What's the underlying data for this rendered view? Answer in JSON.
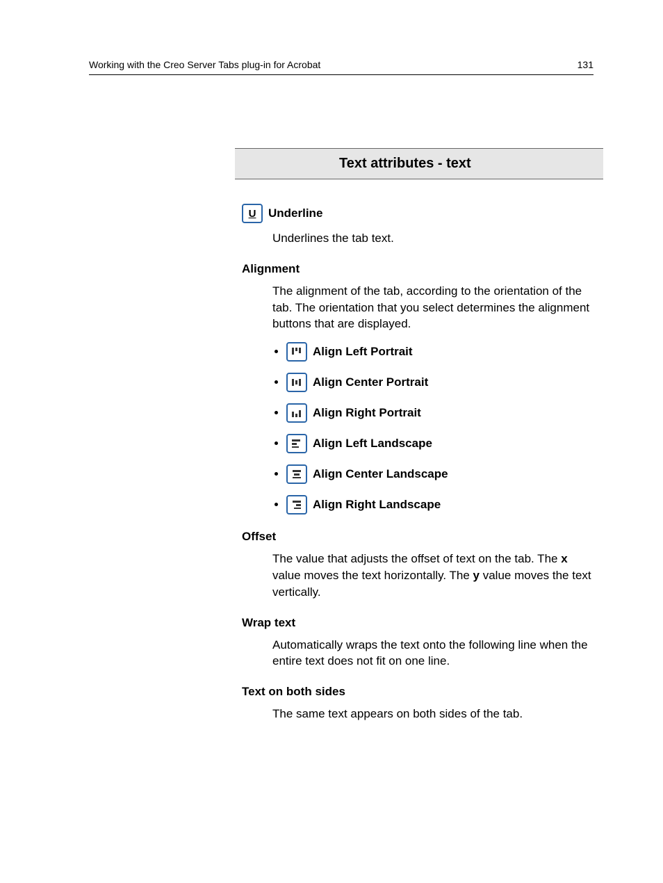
{
  "header": {
    "title": "Working with the Creo Server Tabs plug-in for Acrobat",
    "page": "131"
  },
  "section_title": "Text attributes - text",
  "underline": {
    "label": "Underline",
    "body": "Underlines the tab text."
  },
  "alignment": {
    "label": "Alignment",
    "body": "The alignment of the tab, according to the orientation of the tab. The orientation that you select determines the alignment buttons that are displayed.",
    "items": [
      "Align Left Portrait",
      "Align Center Portrait",
      "Align Right Portrait",
      "Align Left Landscape",
      "Align Center Landscape",
      "Align Right Landscape"
    ]
  },
  "offset": {
    "label": "Offset",
    "body_parts": {
      "p1": "The value that adjusts the offset of text on the tab. The ",
      "x": "x",
      "p2": " value moves the text horizontally. The ",
      "y": "y",
      "p3": " value moves the text vertically."
    }
  },
  "wrap": {
    "label": "Wrap text",
    "body": "Automatically wraps the text onto the following line when the entire text does not fit on one line."
  },
  "bothsides": {
    "label": "Text on both sides",
    "body": "The same text appears on both sides of the tab."
  }
}
